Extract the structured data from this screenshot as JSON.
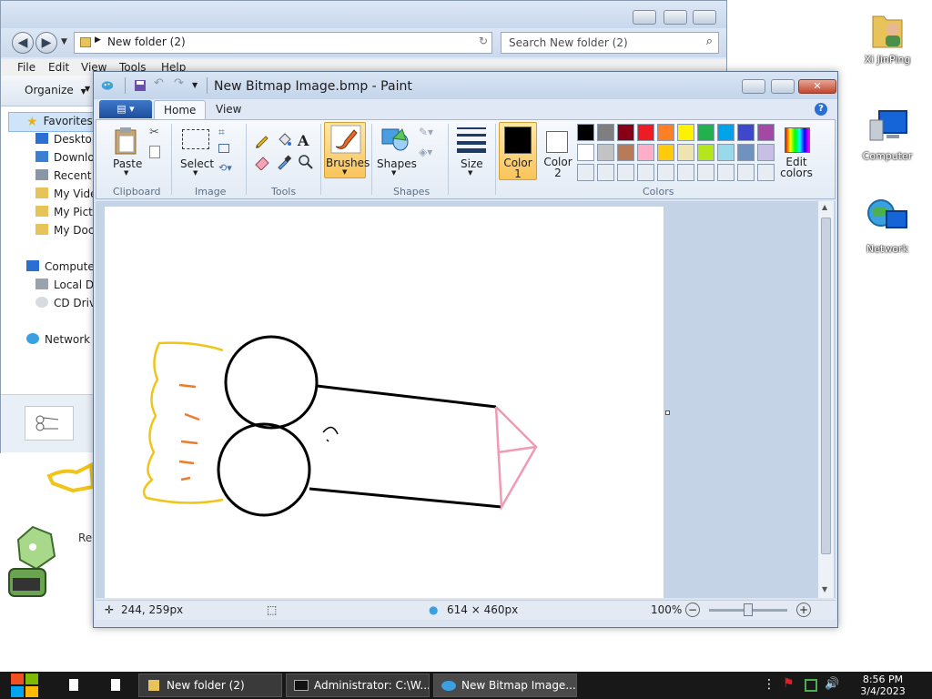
{
  "desktop": {
    "icons": [
      {
        "label": "Xi JinPing",
        "icon": "user-folder-icon"
      },
      {
        "label": "Computer",
        "icon": "computer-icon"
      },
      {
        "label": "Network",
        "icon": "network-icon"
      }
    ],
    "partial_label": "Re"
  },
  "explorer": {
    "address": "New folder (2)",
    "search_placeholder": "Search New folder (2)",
    "menu": [
      "File",
      "Edit",
      "View",
      "Tools",
      "Help"
    ],
    "organize_label": "Organize",
    "nav": [
      {
        "label": "Favorites",
        "icon": "star-icon"
      },
      {
        "label": "Desktop",
        "icon": "desktop-icon"
      },
      {
        "label": "Downloads",
        "icon": "downloads-icon"
      },
      {
        "label": "Recent Places",
        "icon": "recent-icon"
      },
      {
        "label": "My Videos",
        "icon": "videos-icon"
      },
      {
        "label": "My Pictures",
        "icon": "pictures-icon"
      },
      {
        "label": "My Documents",
        "icon": "documents-icon"
      },
      {
        "label": "Computer",
        "icon": "computer-icon"
      },
      {
        "label": "Local Disk",
        "icon": "disk-icon"
      },
      {
        "label": "CD Drive",
        "icon": "cd-icon"
      },
      {
        "label": "Network",
        "icon": "network-icon"
      }
    ]
  },
  "paint": {
    "title": "New Bitmap Image.bmp - Paint",
    "tabs": [
      "Home",
      "View"
    ],
    "groups": {
      "clipboard": "Clipboard",
      "image": "Image",
      "tools": "Tools",
      "shapes": "Shapes",
      "colors": "Colors"
    },
    "buttons": {
      "paste": "Paste",
      "select": "Select",
      "brushes": "Brushes",
      "shapes": "Shapes",
      "size": "Size",
      "color1": "Color\n1",
      "color2": "Color\n2",
      "edit_colors": "Edit\ncolors"
    },
    "color1_value": "#000000",
    "color2_value": "#ffffff",
    "palette_row1": [
      "#000000",
      "#7f7f7f",
      "#880015",
      "#ed1c24",
      "#ff7f27",
      "#fff200",
      "#22b14c",
      "#00a2e8",
      "#3f48cc",
      "#a349a4"
    ],
    "palette_row2": [
      "#ffffff",
      "#c3c3c3",
      "#b97a57",
      "#ffaec9",
      "#ffc90e",
      "#efe4b0",
      "#b5e61d",
      "#99d9ea",
      "#7092be",
      "#c8bfe7"
    ],
    "status": {
      "cursor": "244, 259px",
      "size": "614 × 460px",
      "zoom": "100%"
    }
  },
  "taskbar": {
    "buttons": [
      "New folder (2)",
      "Administrator: C:\\W...",
      "New Bitmap Image...."
    ],
    "time": "8:56 PM",
    "date": "3/4/2023"
  }
}
